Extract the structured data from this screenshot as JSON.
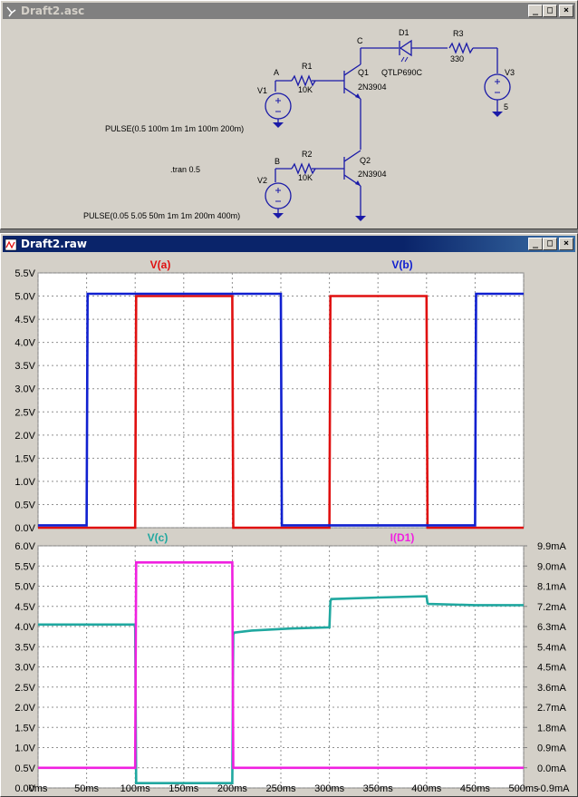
{
  "schematic_window": {
    "title": "Draft2.asc",
    "min_label": "_",
    "max_label": "□",
    "close_label": "×",
    "labels": {
      "C": "C",
      "D1": "D1",
      "R3": "R3",
      "A": "A",
      "R1": "R1",
      "Q1": "Q1",
      "QTLP": "QTLP690C",
      "R3val": "330",
      "V3": "V3",
      "V1": "V1",
      "R1val": "10K",
      "Q1model": "2N3904",
      "V3val": "5",
      "pulse1": "PULSE(0.5 100m 1m 1m 100m 200m)",
      "R2": "R2",
      "B": "B",
      "Q2": "Q2",
      "tran": ".tran 0.5",
      "V2": "V2",
      "R2val": "10K",
      "Q2model": "2N3904",
      "pulse2": "PULSE(0.05 5.05 50m 1m 1m 200m 400m)"
    }
  },
  "waveform_window": {
    "title": "Draft2.raw",
    "min_label": "_",
    "max_label": "□",
    "close_label": "×"
  },
  "colors": {
    "red": "#e01010",
    "blue": "#1020d0",
    "teal": "#20a8a0",
    "magenta": "#f020e0",
    "wire": "#1a1aa8",
    "grid": "#909090"
  },
  "chart_data": [
    {
      "type": "line",
      "title": "",
      "ylim": [
        0,
        5.5
      ],
      "xlim": [
        0,
        500
      ],
      "y_ticks": [
        "0.0V",
        "0.5V",
        "1.0V",
        "1.5V",
        "2.0V",
        "2.5V",
        "3.0V",
        "3.5V",
        "4.0V",
        "4.5V",
        "5.0V",
        "5.5V"
      ],
      "y_tick_values": [
        0,
        0.5,
        1,
        1.5,
        2,
        2.5,
        3,
        3.5,
        4,
        4.5,
        5,
        5.5
      ],
      "grid": true,
      "series": [
        {
          "name": "V(a)",
          "color": "#e01010",
          "x": [
            0,
            100,
            101,
            200,
            201,
            300,
            301,
            400,
            401,
            500
          ],
          "y": [
            0,
            0,
            5,
            5,
            0,
            0,
            5,
            5,
            0,
            0
          ]
        },
        {
          "name": "V(b)",
          "color": "#1020d0",
          "x": [
            0,
            50,
            51,
            250,
            251,
            450,
            451,
            500
          ],
          "y": [
            0.05,
            0.05,
            5.05,
            5.05,
            0.05,
            0.05,
            5.05,
            5.05
          ]
        }
      ]
    },
    {
      "type": "line",
      "title": "",
      "ylim": [
        0,
        6
      ],
      "ylim_right": [
        -0.9,
        9.9
      ],
      "xlim": [
        0,
        500
      ],
      "y_ticks": [
        "0.0V",
        "0.5V",
        "1.0V",
        "1.5V",
        "2.0V",
        "2.5V",
        "3.0V",
        "3.5V",
        "4.0V",
        "4.5V",
        "5.0V",
        "5.5V",
        "6.0V"
      ],
      "y_tick_values": [
        0,
        0.5,
        1,
        1.5,
        2,
        2.5,
        3,
        3.5,
        4,
        4.5,
        5,
        5.5,
        6
      ],
      "y_ticks_right": [
        "-0.9mA",
        "0.0mA",
        "0.9mA",
        "1.8mA",
        "2.7mA",
        "3.6mA",
        "4.5mA",
        "5.4mA",
        "6.3mA",
        "7.2mA",
        "8.1mA",
        "9.0mA",
        "9.9mA"
      ],
      "y_tick_values_right": [
        -0.9,
        0,
        0.9,
        1.8,
        2.7,
        3.6,
        4.5,
        5.4,
        6.3,
        7.2,
        8.1,
        9.0,
        9.9
      ],
      "x_ticks": [
        "0ms",
        "50ms",
        "100ms",
        "150ms",
        "200ms",
        "250ms",
        "300ms",
        "350ms",
        "400ms",
        "450ms",
        "500ms"
      ],
      "x_tick_values": [
        0,
        50,
        100,
        150,
        200,
        250,
        300,
        350,
        400,
        450,
        500
      ],
      "grid": true,
      "series": [
        {
          "name": "V(c)",
          "color": "#20a8a0",
          "axis": "left",
          "x": [
            0,
            100,
            101,
            200,
            201,
            202,
            220,
            260,
            300,
            301,
            302,
            350,
            400,
            401,
            402,
            450,
            500
          ],
          "y": [
            4.05,
            4.05,
            0.12,
            0.12,
            3.8,
            3.85,
            3.9,
            3.95,
            3.98,
            4.62,
            4.68,
            4.72,
            4.75,
            4.58,
            4.56,
            4.53,
            4.53
          ]
        },
        {
          "name": "I(D1)",
          "color": "#f020e0",
          "axis": "right",
          "x": [
            0,
            100,
            101,
            200,
            201,
            500
          ],
          "y": [
            0,
            0,
            9.16,
            9.16,
            0,
            0
          ]
        }
      ]
    }
  ]
}
